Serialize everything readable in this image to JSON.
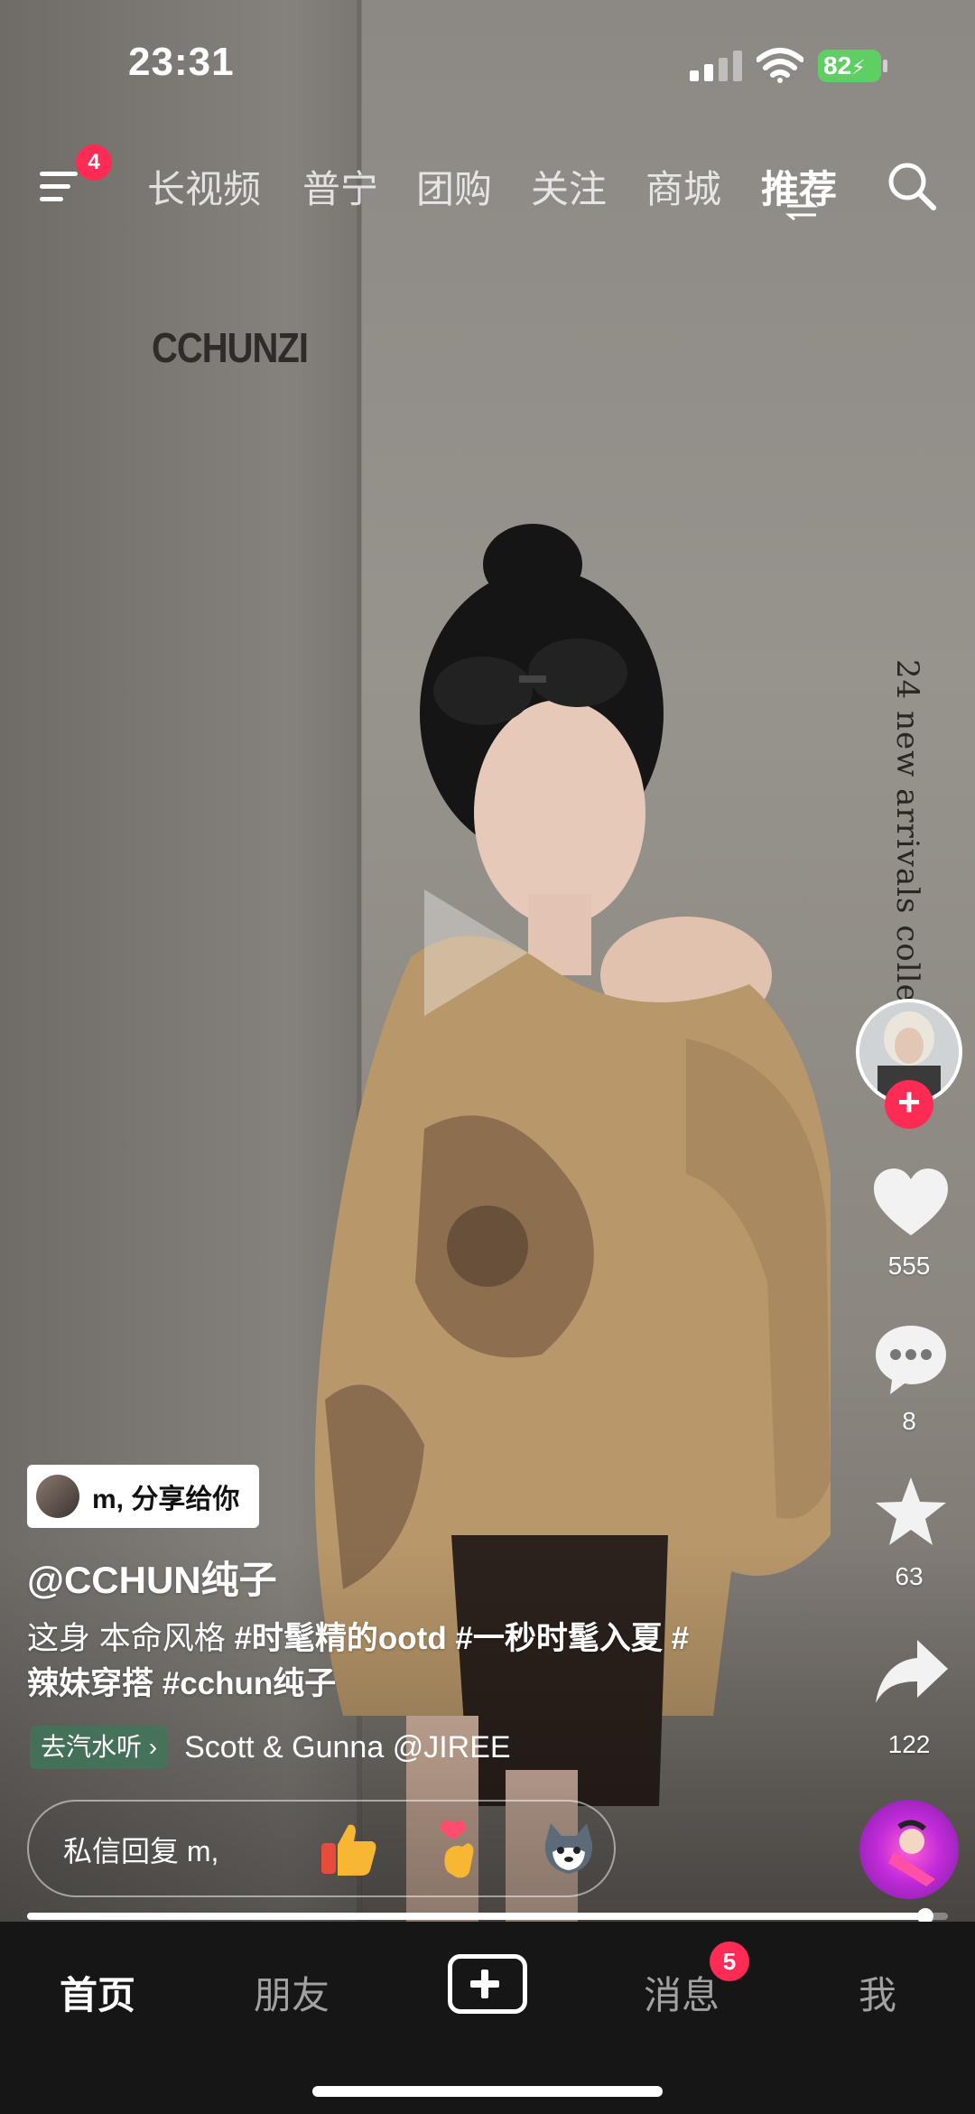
{
  "status_bar": {
    "time": "23:31",
    "battery": "82"
  },
  "top_nav": {
    "menu_badge": "4",
    "tabs": [
      {
        "label": "长视频"
      },
      {
        "label": "普宁"
      },
      {
        "label": "团购"
      },
      {
        "label": "关注"
      },
      {
        "label": "商城"
      },
      {
        "label": "推荐",
        "active": true
      }
    ]
  },
  "video": {
    "wall_brand": "CCHUNZI",
    "vertical_text": "24 new arrivals collection"
  },
  "actions": {
    "likes": "555",
    "comments": "8",
    "favorites": "63",
    "shares": "122",
    "follow_symbol": "+"
  },
  "post": {
    "share_chip": "m, 分享给你",
    "author": "@CCHUN纯子",
    "desc_plain": "这身 本命风格 ",
    "tags_line1": "#时髦精的ootd #一秒时髦入夏 #",
    "tags_line2": "辣妹穿搭 #cchun纯子",
    "music_chip": "去汽水听 ›",
    "music_name": "Scott & Gunna    @JIREE"
  },
  "reply": {
    "placeholder": "私信回复 m,"
  },
  "progress": {
    "fraction": 0.975
  },
  "bottom_nav": {
    "home": "首页",
    "friends": "朋友",
    "messages": "消息",
    "messages_badge": "5",
    "me": "我"
  }
}
